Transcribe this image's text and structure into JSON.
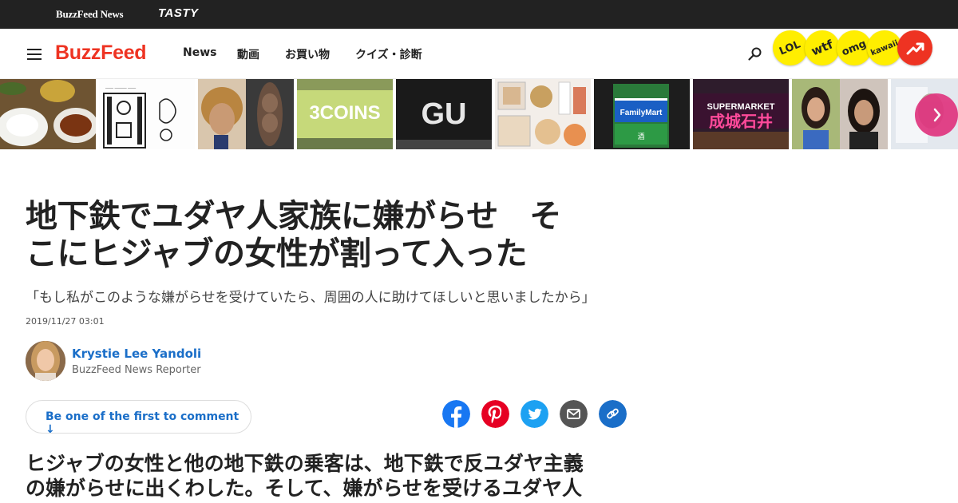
{
  "topbar": {
    "buzzfeed_news": "BuzzFeed News",
    "tasty": "TASTY"
  },
  "header": {
    "logo": "BuzzFeed",
    "nav": [
      "News",
      "動画",
      "お買い物",
      "クイズ・診断"
    ],
    "badges": [
      "LOL",
      "wtf",
      "omg",
      "kawaii"
    ],
    "trending_icon": "trending-arrow-icon",
    "search_icon": "search-icon"
  },
  "strip": {
    "thumbs": [
      {
        "name": "food-thumb"
      },
      {
        "name": "illustration-thumb"
      },
      {
        "name": "hair-thumb"
      },
      {
        "name": "3coins-thumb",
        "text": "3COINS"
      },
      {
        "name": "gu-thumb",
        "text": "GU"
      },
      {
        "name": "cosmetics-thumb"
      },
      {
        "name": "familymart-thumb",
        "text": "FamilyMart"
      },
      {
        "name": "seijo-ishii-thumb",
        "text": "SUPERMARKET",
        "text2": "成城石井"
      },
      {
        "name": "people-thumb"
      },
      {
        "name": "partial-thumb"
      }
    ],
    "next_icon": "chevron-right-icon"
  },
  "article": {
    "headline_line1": "地下鉄でユダヤ人家族に嫌がらせ　そ",
    "headline_line2": "こにヒジャブの女性が割って入った",
    "dek": "「もし私がこのような嫌がらせを受けていたら、周囲の人に助けてほしいと思いましたから」",
    "timestamp": "2019/11/27 03:01",
    "author": {
      "name": "Krystie Lee Yandoli",
      "title": "BuzzFeed News Reporter"
    },
    "comment_cta": "Be one of the first to comment ↓",
    "share_icons": [
      "facebook-icon",
      "pinterest-icon",
      "twitter-icon",
      "email-icon",
      "link-icon"
    ],
    "body_line1": "ヒジャブの女性と他の地下鉄の乗客は、地下鉄で反ユダヤ主義",
    "body_line2": "の嫌がらせに出くわした。そして、嫌がらせを受けるユダヤ人"
  },
  "colors": {
    "brand": "#ee3322",
    "link": "#1a6ec8",
    "badge": "#ffee00",
    "next": "#e0357f"
  }
}
